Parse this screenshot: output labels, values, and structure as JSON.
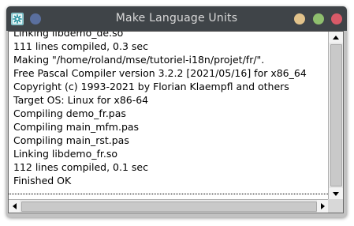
{
  "window": {
    "title": "Make Language Units"
  },
  "output": {
    "lines": [
      "Linking libdemo_de.so",
      "111 lines compiled, 0.3 sec",
      "Making \"/home/roland/mse/tutoriel-i18n/projet/fr/\".",
      "Free Pascal Compiler version 3.2.2 [2021/05/16] for x86_64",
      "Copyright (c) 1993-2021 by Florian Klaempfl and others",
      "Target OS: Linux for x86-64",
      "Compiling demo_fr.pas",
      "Compiling main_mfm.pas",
      "Compiling main_rst.pas",
      "Linking libdemo_fr.so",
      "112 lines compiled, 0.1 sec",
      "Finished OK"
    ]
  },
  "icons": {
    "app": "app-icon",
    "menu": "window-menu-icon",
    "minimize": "minimize-icon",
    "maximize": "maximize-icon",
    "close": "close-icon",
    "scroll_up": "arrow-up-icon",
    "scroll_down": "arrow-down-icon",
    "scroll_left": "arrow-left-icon",
    "scroll_right": "arrow-right-icon"
  },
  "colors": {
    "titlebar": "#3f4448",
    "close": "#d85a68",
    "maximize": "#8fbf6e",
    "minimize": "#e2c38b",
    "menu": "#5a6f9e"
  }
}
